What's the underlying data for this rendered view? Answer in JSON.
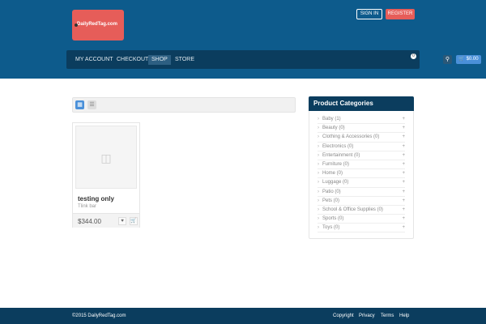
{
  "header": {
    "logo": "DailyRedTag.com",
    "sign_in": "SIGN IN",
    "register": "REGISTER"
  },
  "nav": {
    "items": [
      "MY ACCOUNT",
      "CHECKOUT",
      "SHOP",
      "STORE"
    ],
    "active": "SHOP",
    "cart_total": "$0.00",
    "cart_count": "0",
    "search_icon": "⌕",
    "cart_icon": "🛒"
  },
  "product": {
    "title": "testing only",
    "subtitle": "Tlink bar",
    "price": "$344.00"
  },
  "sidebar": {
    "title": "Product Categories",
    "items": [
      "Baby (1)",
      "Beauty (0)",
      "Clothing & Accessories (0)",
      "Electronics (0)",
      "Entertainment (0)",
      "Furniture (0)",
      "Home (0)",
      "Luggage (0)",
      "Patio (0)",
      "Pets (0)",
      "School & Office Supplies (0)",
      "Sports (0)",
      "Toys (0)"
    ]
  },
  "footer": {
    "copyright": "©2015 DailyRedTag.com",
    "links": [
      "Copyright",
      "Privacy",
      "Terms",
      "Help"
    ]
  }
}
